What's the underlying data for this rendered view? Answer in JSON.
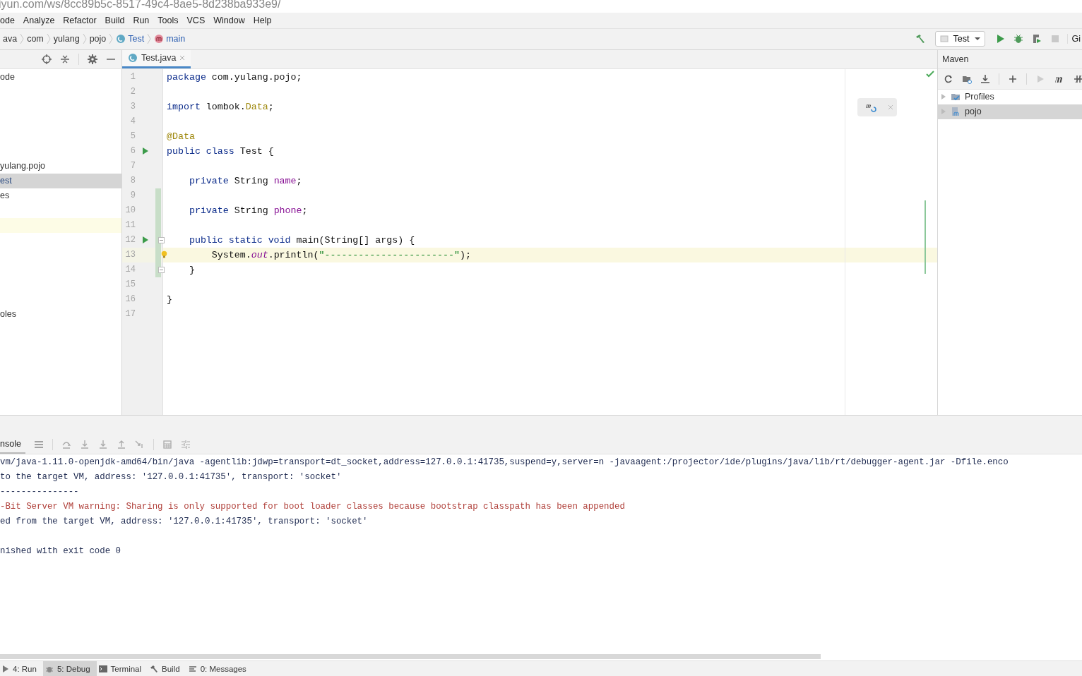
{
  "url_bar": {
    "text": "iyun.com/ws/8cc89b5c-8517-49c4-8ae5-8d238ba933e9/"
  },
  "menu": [
    "ode",
    "Analyze",
    "Refactor",
    "Build",
    "Run",
    "Tools",
    "VCS",
    "Window",
    "Help"
  ],
  "breadcrumbs": [
    {
      "label": "ava",
      "kind": "folder"
    },
    {
      "label": "com",
      "kind": "folder"
    },
    {
      "label": "yulang",
      "kind": "folder"
    },
    {
      "label": "pojo",
      "kind": "folder"
    },
    {
      "label": "Test",
      "kind": "class"
    },
    {
      "label": "main",
      "kind": "method"
    }
  ],
  "toolbar": {
    "run_config": "Test",
    "cut_label": "Gi"
  },
  "project_panel": {
    "items": [
      {
        "label": "ode",
        "selected": false,
        "highlighted": false
      },
      {
        "selected": false,
        "highlighted": false
      },
      {
        "selected": false,
        "highlighted": false
      },
      {
        "selected": false,
        "highlighted": false
      },
      {
        "selected": false,
        "highlighted": false
      },
      {
        "selected": false,
        "highlighted": false
      },
      {
        "label": "yulang.pojo",
        "selected": false,
        "highlighted": false
      },
      {
        "label": "est",
        "selected": true,
        "highlighted": false
      },
      {
        "label": "es",
        "selected": false,
        "highlighted": false
      },
      {
        "selected": false,
        "highlighted": false
      },
      {
        "selected": false,
        "highlighted": true
      },
      {
        "selected": false,
        "highlighted": false
      },
      {
        "selected": false,
        "highlighted": false
      },
      {
        "selected": false,
        "highlighted": false
      },
      {
        "selected": false,
        "highlighted": false
      },
      {
        "selected": false,
        "highlighted": false
      },
      {
        "label": "oles",
        "selected": false,
        "highlighted": false
      }
    ]
  },
  "editor": {
    "tabs": [
      {
        "label": "Test.java",
        "selected": true
      }
    ],
    "lines": [
      {
        "n": "1",
        "tokens": [
          {
            "text": "package",
            "kind": "kw"
          },
          {
            "text": " com.yulang.pojo;",
            "kind": "plain"
          }
        ],
        "run": false,
        "fold": false,
        "bulb": false,
        "current": false,
        "changed": false
      },
      {
        "n": "2",
        "run": false,
        "fold": false,
        "bulb": false,
        "current": false,
        "changed": false
      },
      {
        "n": "3",
        "tokens": [
          {
            "text": "import",
            "kind": "kw"
          },
          {
            "text": " lombok.",
            "kind": "plain"
          },
          {
            "text": "Data",
            "kind": "ann"
          },
          {
            "text": ";",
            "kind": "plain"
          }
        ],
        "run": false,
        "fold": false,
        "bulb": false,
        "current": false,
        "changed": false
      },
      {
        "n": "4",
        "run": false,
        "fold": false,
        "bulb": false,
        "current": false,
        "changed": false
      },
      {
        "n": "5",
        "tokens": [
          {
            "text": "@Data",
            "kind": "ann"
          }
        ],
        "run": false,
        "fold": false,
        "bulb": false,
        "current": false,
        "changed": false
      },
      {
        "n": "6",
        "tokens": [
          {
            "text": "public class",
            "kind": "kw"
          },
          {
            "text": " Test {",
            "kind": "plain"
          }
        ],
        "run": true,
        "fold": false,
        "bulb": false,
        "current": false,
        "changed": false
      },
      {
        "n": "7",
        "run": false,
        "fold": false,
        "bulb": false,
        "current": false,
        "changed": false
      },
      {
        "n": "8",
        "tokens": [
          {
            "text": "    private",
            "kind": "kw"
          },
          {
            "text": " String ",
            "kind": "plain"
          },
          {
            "text": "name",
            "kind": "field"
          },
          {
            "text": ";",
            "kind": "plain"
          }
        ],
        "run": false,
        "fold": false,
        "bulb": false,
        "current": false,
        "changed": false
      },
      {
        "n": "9",
        "run": false,
        "fold": false,
        "bulb": false,
        "current": false,
        "changed": true
      },
      {
        "n": "10",
        "tokens": [
          {
            "text": "    private",
            "kind": "kw"
          },
          {
            "text": " String ",
            "kind": "plain"
          },
          {
            "text": "phone",
            "kind": "field"
          },
          {
            "text": ";",
            "kind": "plain"
          }
        ],
        "run": false,
        "fold": false,
        "bulb": false,
        "current": false,
        "changed": true
      },
      {
        "n": "11",
        "run": false,
        "fold": false,
        "bulb": false,
        "current": false,
        "changed": true
      },
      {
        "n": "12",
        "tokens": [
          {
            "text": "    public static void",
            "kind": "kw"
          },
          {
            "text": " main(String[] args) {",
            "kind": "plain"
          }
        ],
        "run": true,
        "fold": true,
        "bulb": false,
        "current": false,
        "changed": true
      },
      {
        "n": "13",
        "tokens": [
          {
            "text": "        System.",
            "kind": "plain"
          },
          {
            "text": "out",
            "kind": "static"
          },
          {
            "text": ".println(",
            "kind": "plain"
          },
          {
            "text": "\"-----------------------\"",
            "kind": "str"
          },
          {
            "text": ");",
            "kind": "plain"
          }
        ],
        "run": false,
        "fold": false,
        "bulb": true,
        "current": true,
        "changed": true
      },
      {
        "n": "14",
        "tokens": [
          {
            "text": "    }",
            "kind": "plain"
          }
        ],
        "run": false,
        "fold": true,
        "bulb": false,
        "current": false,
        "changed": true
      },
      {
        "n": "15",
        "run": false,
        "fold": false,
        "bulb": false,
        "current": false,
        "changed": false
      },
      {
        "n": "16",
        "tokens": [
          {
            "text": "}",
            "kind": "plain"
          }
        ],
        "run": false,
        "fold": false,
        "bulb": false,
        "current": false,
        "changed": false
      },
      {
        "n": "17",
        "run": false,
        "fold": false,
        "bulb": false,
        "current": false,
        "changed": false
      }
    ]
  },
  "maven": {
    "title": "Maven",
    "tree": [
      {
        "label": "Profiles",
        "kind": "profiles",
        "selected": false
      },
      {
        "label": "pojo",
        "kind": "module",
        "selected": true
      }
    ]
  },
  "console": {
    "tab": "nsole",
    "lines": [
      {
        "text": "vm/java-1.11.0-openjdk-amd64/bin/java -agentlib:jdwp=transport=dt_socket,address=127.0.0.1:41735,suspend=y,server=n -javaagent:/projector/ide/plugins/java/lib/rt/debugger-agent.jar -Dfile.enco",
        "kind": "plain"
      },
      {
        "text": "to the target VM, address: '127.0.0.1:41735', transport: 'socket'",
        "kind": "plain"
      },
      {
        "text": "---------------",
        "kind": "plain"
      },
      {
        "text": "-Bit Server VM warning: Sharing is only supported for boot loader classes because bootstrap classpath has been appended",
        "kind": "warning"
      },
      {
        "text": "ed from the target VM, address: '127.0.0.1:41735', transport: 'socket'",
        "kind": "plain"
      },
      {
        "kind": "blank"
      },
      {
        "text": "nished with exit code 0",
        "kind": "plain"
      }
    ]
  },
  "bottom_bar": [
    {
      "label": "4: Run",
      "kind": "run",
      "selected": false
    },
    {
      "label": "5: Debug",
      "kind": "debug",
      "selected": true
    },
    {
      "label": "Terminal",
      "kind": "terminal",
      "selected": false
    },
    {
      "label": "Build",
      "kind": "build",
      "selected": false
    },
    {
      "label": "0: Messages",
      "kind": "messages",
      "selected": false
    }
  ]
}
